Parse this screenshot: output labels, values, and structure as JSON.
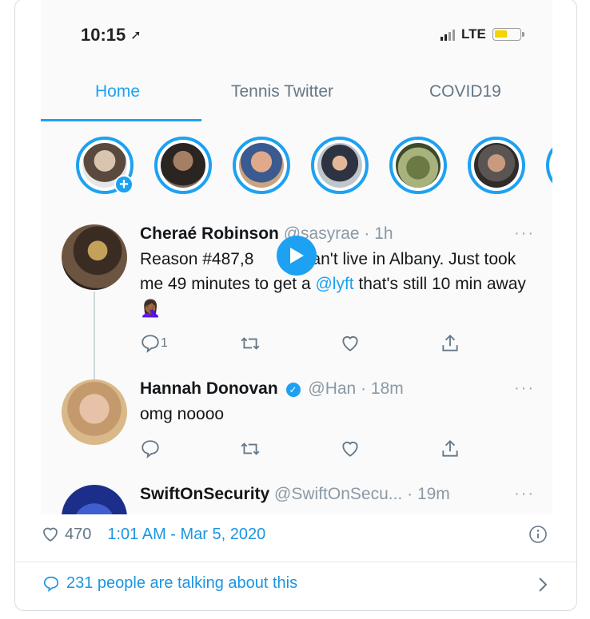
{
  "status_bar": {
    "time": "10:15",
    "network": "LTE"
  },
  "tabs": [
    {
      "label": "Home",
      "active": true
    },
    {
      "label": "Tennis Twitter",
      "active": false
    },
    {
      "label": "COVID19",
      "active": false
    }
  ],
  "tweets": [
    {
      "name": "Cheraé Robinson",
      "handle": "@sasyrae",
      "time": "1h",
      "text_parts": [
        "Reason #487,8",
        "an't live in Albany. Just took me 49 minutes to get a ",
        "@lyft",
        " that's still 10 min away 🤦🏾‍♀️"
      ],
      "replies": "1"
    },
    {
      "name": "Hannah Donovan",
      "handle": "@Han",
      "time": "18m",
      "text": "omg noooo",
      "verified": true
    },
    {
      "name": "SwiftOnSecurity",
      "handle": "@SwiftOnSecu...",
      "time": "19m"
    }
  ],
  "embed_meta": {
    "likes": "470",
    "timestamp": "1:01 AM - Mar 5, 2020",
    "talking": "231 people are talking about this"
  },
  "colors": {
    "accent": "#1da1f2",
    "link": "#1b95e0",
    "muted": "#657786"
  },
  "icons": [
    "location-arrow-icon",
    "signal-icon",
    "battery-icon",
    "add-fleet-icon",
    "play-icon",
    "reply-icon",
    "retweet-icon",
    "like-icon",
    "share-icon",
    "more-icon",
    "verified-icon",
    "info-icon",
    "chevron-right-icon"
  ]
}
